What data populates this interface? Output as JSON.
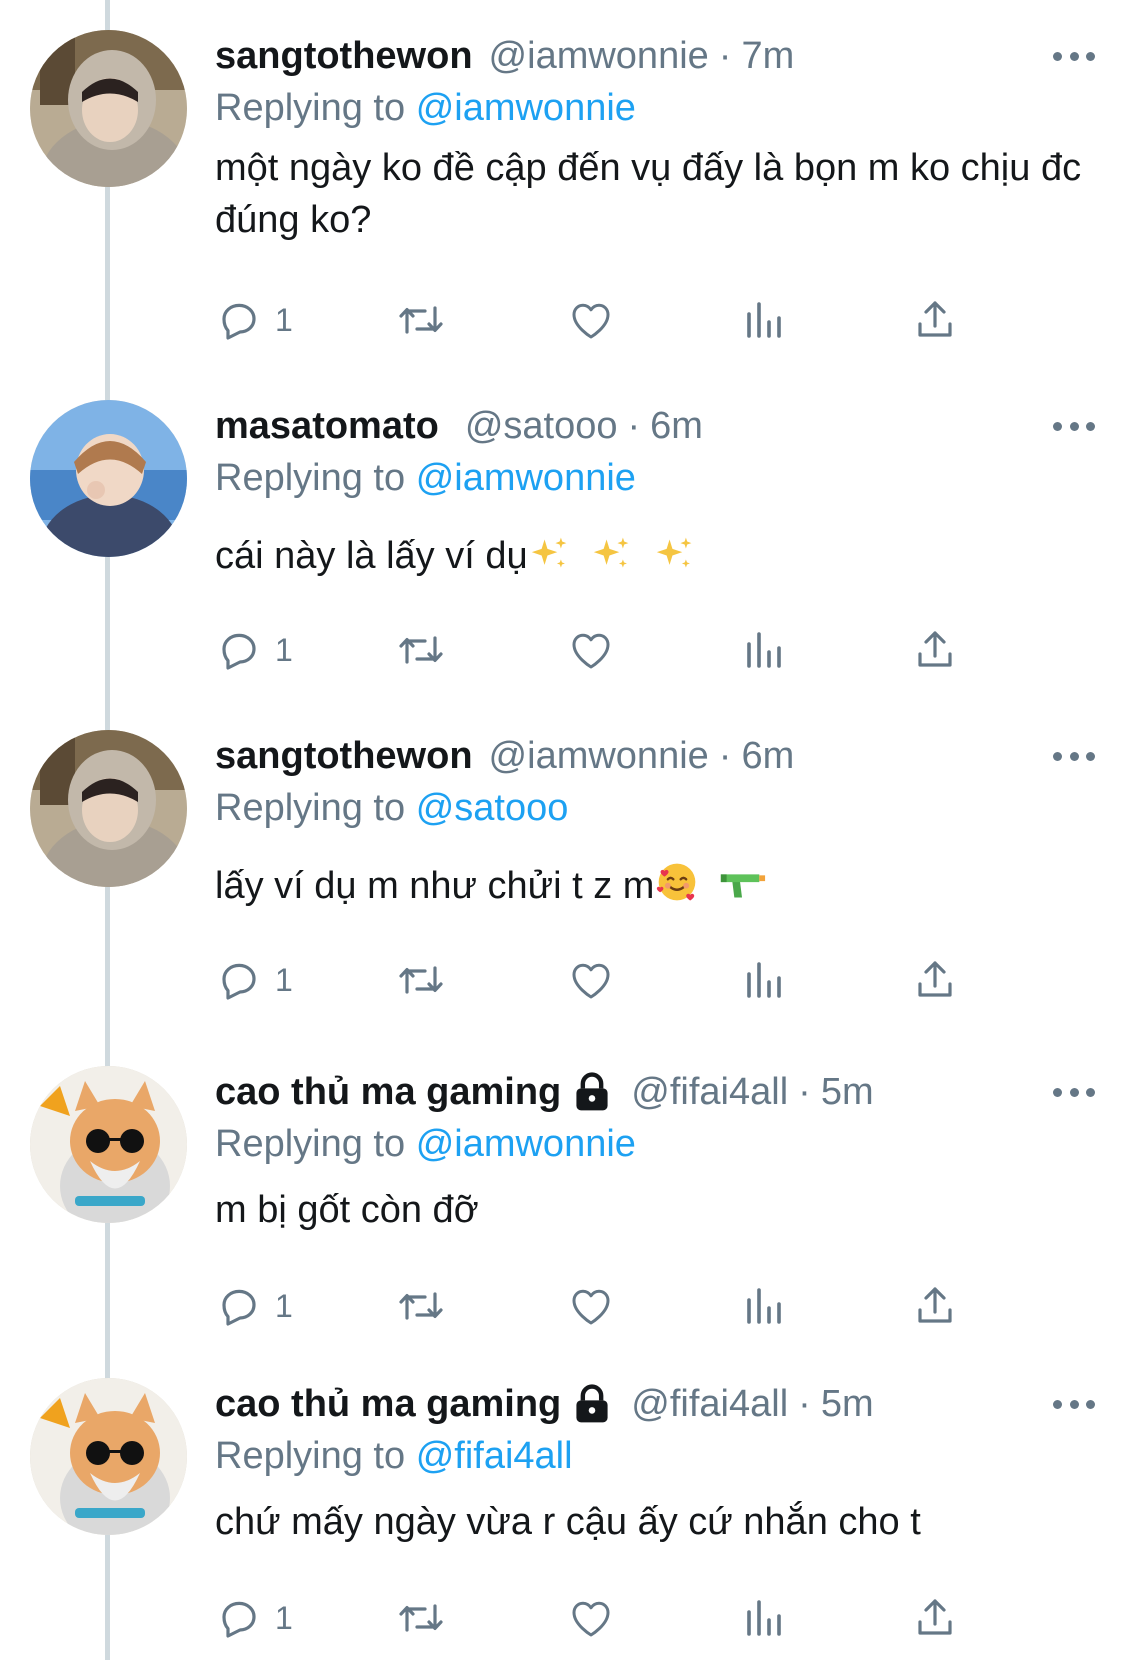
{
  "colors": {
    "link": "#1da1f2",
    "secondary": "#657786",
    "text": "#14171a",
    "thread_line": "#cfd9de"
  },
  "replying_prefix": "Replying to",
  "tweets": [
    {
      "display_name": "sangtothewon",
      "locked": false,
      "handle": "@iamwonnie",
      "separator": "·",
      "time": "7m",
      "replying_to": "@iamwonnie",
      "text": "một ngày ko đề cập đến vụ đấy là bọn m ko chịu đc đúng ko?",
      "emojis": [],
      "reply_count": "1",
      "avatar": "avatar-hooded-person"
    },
    {
      "display_name": "masatomato",
      "locked": false,
      "handle": "@satooo",
      "separator": "·",
      "time": "6m",
      "replying_to": "@iamwonnie",
      "text": "cái này là lấy ví dụ",
      "emojis": [
        "sparkles-emoji",
        "sparkles-emoji",
        "sparkles-emoji"
      ],
      "reply_count": "1",
      "avatar": "avatar-performer"
    },
    {
      "display_name": "sangtothewon",
      "locked": false,
      "handle": "@iamwonnie",
      "separator": "·",
      "time": "6m",
      "replying_to": "@satooo",
      "text": "lấy ví dụ m như chửi t z m",
      "emojis": [
        "smiling-face-with-hearts-emoji",
        "water-pistol-emoji"
      ],
      "reply_count": "1",
      "avatar": "avatar-hooded-person"
    },
    {
      "display_name": "cao thủ ma gaming",
      "locked": true,
      "handle": "@fifai4all",
      "separator": "·",
      "time": "5m",
      "replying_to": "@iamwonnie",
      "text": "m bị gốt còn đỡ",
      "emojis": [],
      "reply_count": "1",
      "avatar": "avatar-cat-sunglasses"
    },
    {
      "display_name": "cao thủ ma gaming",
      "locked": true,
      "handle": "@fifai4all",
      "separator": "·",
      "time": "5m",
      "replying_to": "@fifai4all",
      "text": "chứ mấy ngày vừa r cậu ấy cứ nhắn cho t",
      "emojis": [],
      "reply_count": "1",
      "avatar": "avatar-cat-sunglasses"
    }
  ]
}
